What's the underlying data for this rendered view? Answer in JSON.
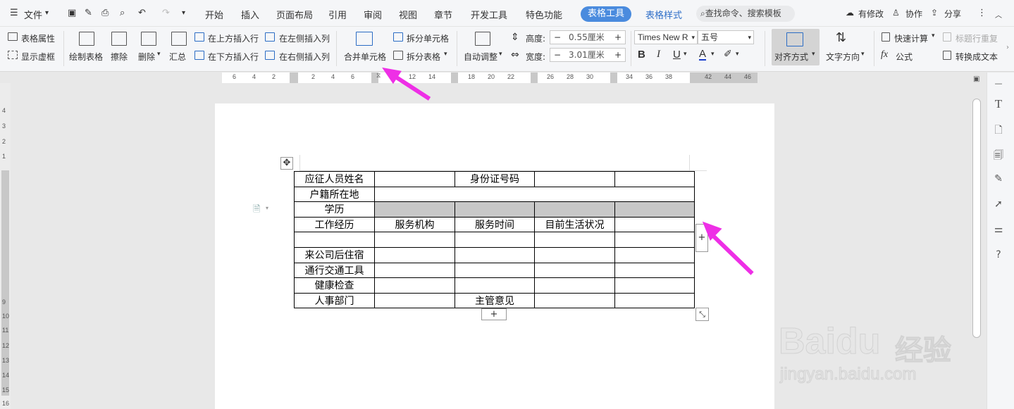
{
  "menubar": {
    "file_menu": "文件",
    "tabs": [
      "开始",
      "插入",
      "页面布局",
      "引用",
      "审阅",
      "视图",
      "章节",
      "开发工具",
      "特色功能"
    ],
    "active_tab": "表格工具",
    "table_style_tab": "表格样式",
    "search_placeholder": "查找命令、搜索模板",
    "modified": "有修改",
    "collab": "协作",
    "share": "分享"
  },
  "ribbon": {
    "table_props": "表格属性",
    "show_gridlines": "显示虚框",
    "draw_table": "绘制表格",
    "erase": "擦除",
    "delete": "删除",
    "summary": "汇总",
    "insert_above": "在上方插入行",
    "insert_below": "在下方插入行",
    "insert_left": "在左侧插入列",
    "insert_right": "在右侧插入列",
    "merge_cells": "合并单元格",
    "split_cells": "拆分单元格",
    "split_table": "拆分表格",
    "auto_fit": "自动调整",
    "height_label": "高度:",
    "height_value": "0.55厘米",
    "width_label": "宽度:",
    "width_value": "3.01厘米",
    "font_name": "Times New R",
    "font_size": "五号",
    "bold": "B",
    "italic": "I",
    "underline": "U",
    "font_color": "A",
    "align": "对齐方式",
    "text_direction": "文字方向",
    "quick_calc": "快速计算",
    "header_repeat": "标题行重复",
    "formula": "公式",
    "to_text": "转换成文本"
  },
  "ruler": {
    "h_ticks": [
      "6",
      "4",
      "2",
      "2",
      "4",
      "6",
      "12",
      "14",
      "18",
      "20",
      "22",
      "26",
      "28",
      "30",
      "34",
      "36",
      "38",
      "42",
      "44",
      "46"
    ],
    "v_ticks": [
      "4",
      "3",
      "2",
      "1",
      "9",
      "10",
      "11",
      "12",
      "13",
      "14",
      "15",
      "16"
    ]
  },
  "table": {
    "rows": [
      [
        "应征人员姓名",
        "",
        "身份证号码",
        "",
        ""
      ],
      [
        "户籍所在地",
        "",
        "",
        "",
        ""
      ],
      [
        "学历",
        "",
        "",
        "",
        ""
      ],
      [
        "工作经历",
        "服务机构",
        "服务时间",
        "目前生活状况",
        ""
      ],
      [
        "",
        "",
        "",
        "",
        ""
      ],
      [
        "来公司后住宿",
        "",
        "",
        "",
        ""
      ],
      [
        "通行交通工具",
        "",
        "",
        "",
        ""
      ],
      [
        "健康检查",
        "",
        "",
        "",
        ""
      ],
      [
        "人事部门",
        "",
        "主管意见",
        "",
        ""
      ]
    ]
  },
  "add_row_button": "+",
  "add_col_button": "+",
  "watermark": {
    "brand": "Baidu",
    "suffix": "经验",
    "url": "jingyan.baidu.com"
  },
  "colors": {
    "accent": "#4a8bde",
    "arrow": "#ee2fe6",
    "gray_row": "#c8c8c8"
  }
}
